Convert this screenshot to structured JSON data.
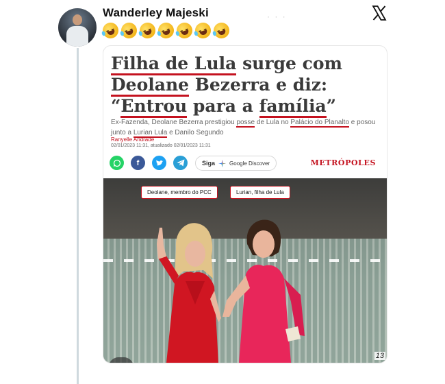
{
  "tweet": {
    "username": "Wanderley Majeski",
    "emoji_count": 7,
    "emoji_name": "rolling-on-the-floor-laughing"
  },
  "article": {
    "headline_parts": [
      "Filha de Lula",
      " surge com ",
      "Deolane",
      " Bezerra e diz: “",
      "Entrou",
      " para a ",
      "família",
      "”"
    ],
    "lede_parts": [
      "Ex-Fazenda, Deolane Bezerra prestigiou ",
      "posse",
      " de Lula no ",
      "Palácio do Planalto",
      " e posou junto a ",
      "Lurian Lula",
      " e Danilo Segundo"
    ],
    "author": "Ranyelle Andrade",
    "dateline": "02/01/2023 11:31, atualizado 02/01/2023 11:31",
    "siga_label": "Siga",
    "google_discover_label": "Google Discover",
    "publisher": "METRÓPOLES",
    "photo_label_left": "Deolane, membro do PCC",
    "photo_label_right": "Lurian, filha de Lula",
    "page_number": "13"
  },
  "colors": {
    "accent_red": "#c4121f",
    "whatsapp": "#25d366",
    "facebook": "#3b5998",
    "twitter": "#1da1f2",
    "telegram": "#2a9fd6"
  }
}
